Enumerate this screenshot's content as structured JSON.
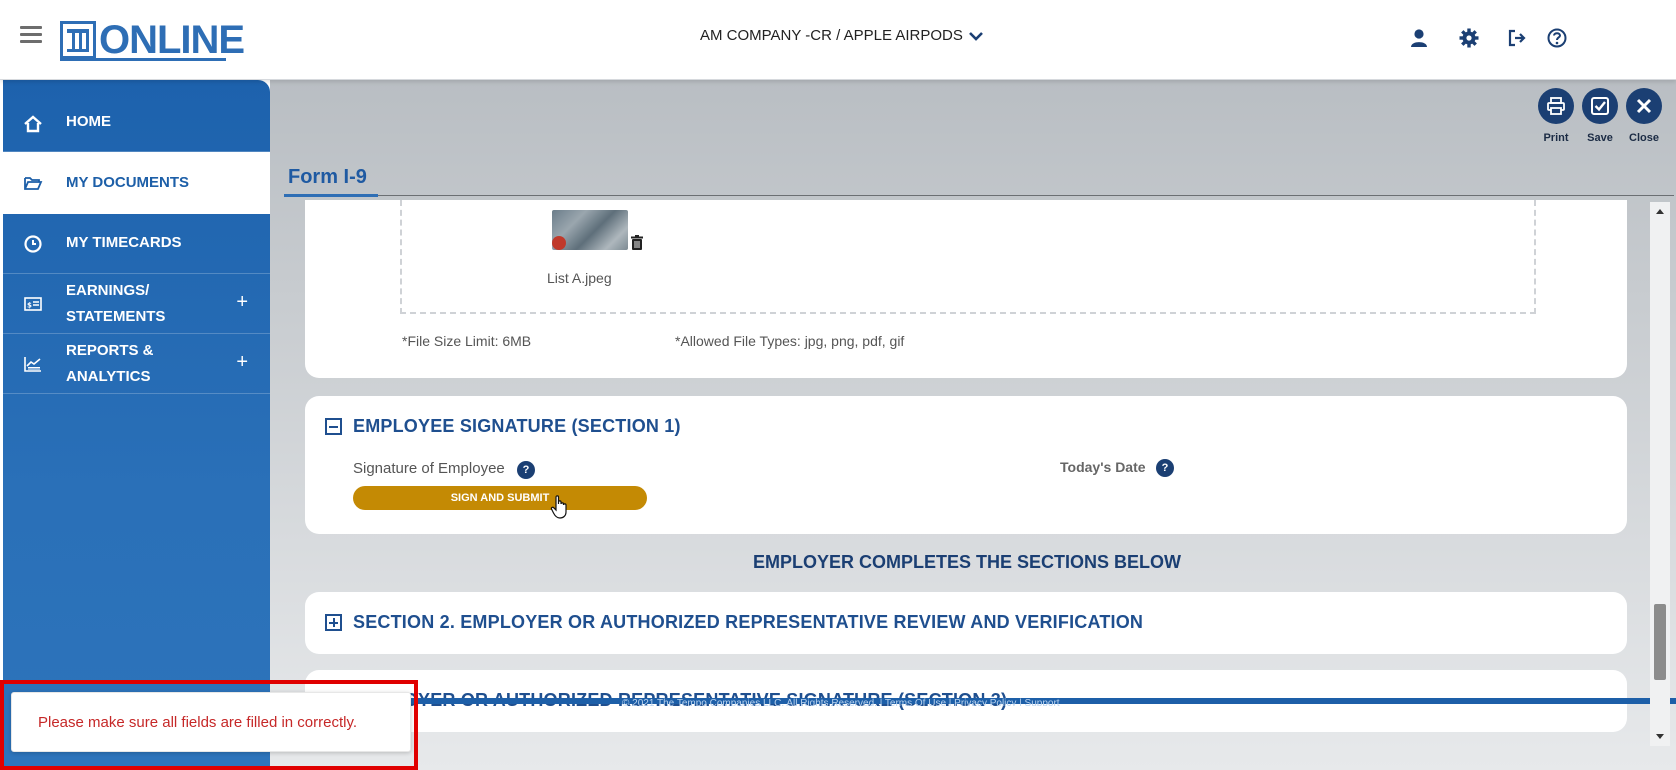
{
  "header": {
    "logo_text": "ONLINE",
    "company_selector": "AM COMPANY -CR / APPLE AIRPODS"
  },
  "sidebar": {
    "items": [
      {
        "label": "HOME",
        "icon": "home-icon"
      },
      {
        "label": "MY DOCUMENTS",
        "icon": "folder-open-icon",
        "active": true
      },
      {
        "label": "MY TIMECARDS",
        "icon": "clock-icon"
      },
      {
        "label_line1": "EARNINGS/",
        "label_line2": "STATEMENTS",
        "icon": "statement-icon",
        "expandable": "+"
      },
      {
        "label_line1": "REPORTS &",
        "label_line2": "ANALYTICS",
        "icon": "report-chart-icon",
        "expandable": "+"
      }
    ]
  },
  "toolbar": {
    "print_label": "Print",
    "save_label": "Save",
    "close_label": "Close"
  },
  "form": {
    "title": "Form I-9",
    "upload": {
      "file_name": "List A.jpeg",
      "size_limit": "*File Size Limit: 6MB",
      "allowed_types": "*Allowed File Types: jpg, png, pdf, gif"
    },
    "employee_signature": {
      "title": "EMPLOYEE SIGNATURE (SECTION 1)",
      "signature_label": "Signature of Employee",
      "date_label": "Today's Date",
      "sign_button": "SIGN AND SUBMIT",
      "help_glyph": "?"
    },
    "employer_heading": "EMPLOYER COMPLETES THE SECTIONS BELOW",
    "section2_title": "SECTION 2. EMPLOYER OR AUTHORIZED REPRESENTATIVE REVIEW AND VERIFICATION",
    "section3_title": "EMPLOYER OR AUTHORIZED REPRESENTATIVE SIGNATURE (SECTION 3)"
  },
  "footer": {
    "copyright": "© 2021 The Tempo Companies LLC. All Rights Reserved. | Terms Of Use | Privacy Policy | Support"
  },
  "toast": {
    "message": "Please make sure all fields are filled in correctly."
  },
  "colors": {
    "brand_blue": "#2e6eb5",
    "sidebar_blue": "#1d62ad",
    "navy": "#1b3f73",
    "sign_button": "#c48a04",
    "toast_text": "#c62828",
    "highlight_outline": "#e00000"
  }
}
